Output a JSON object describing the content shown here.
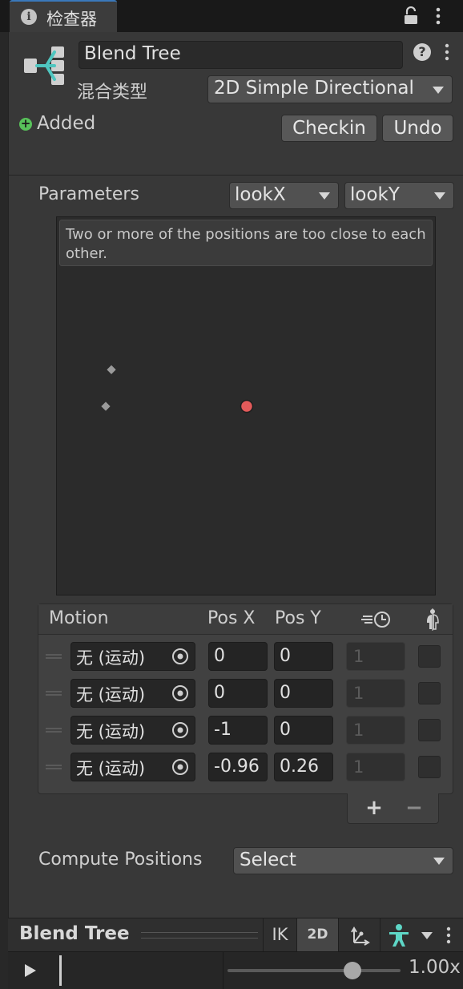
{
  "tab": {
    "title": "检查器",
    "info_icon": "info-icon",
    "lock_icon": "lock-icon",
    "menu_icon": "kebab-menu-icon"
  },
  "header": {
    "name_value": "Blend Tree",
    "help_icon": "help-icon",
    "blend_type_label": "混合类型",
    "blend_type_value": "2D Simple Directional",
    "added_label": "Added",
    "checkin_label": "Checkin",
    "undo_label": "Undo"
  },
  "parameters": {
    "label": "Parameters",
    "param_x": "lookX",
    "param_y": "lookY"
  },
  "blend_graph": {
    "warning": "Two or more of the positions are too close to each other.",
    "points": [
      {
        "x": 0,
        "y": 0
      },
      {
        "x": 0,
        "y": 0
      },
      {
        "x": -1,
        "y": 0
      },
      {
        "x": -0.96,
        "y": 0.26
      }
    ],
    "colors": {
      "point": "#9a9a9a",
      "current": "#e35a5a"
    }
  },
  "motion_table": {
    "headers": {
      "motion": "Motion",
      "pos_x": "Pos X",
      "pos_y": "Pos Y",
      "speed_icon": "time-scale-icon",
      "mirror_icon": "mirror-icon"
    },
    "rows": [
      {
        "motion": "无 (运动)",
        "pos_x": "0",
        "pos_y": "0",
        "speed": "1"
      },
      {
        "motion": "无 (运动)",
        "pos_x": "0",
        "pos_y": "0",
        "speed": "1"
      },
      {
        "motion": "无 (运动)",
        "pos_x": "-1",
        "pos_y": "0",
        "speed": "1"
      },
      {
        "motion": "无 (运动)",
        "pos_x": "-0.96",
        "pos_y": "0.26",
        "speed": "1"
      }
    ],
    "add_label": "+",
    "remove_label": "−"
  },
  "compute": {
    "label": "Compute Positions",
    "value": "Select"
  },
  "bottom": {
    "title": "Blend Tree",
    "ik_label": "IK",
    "mode_2d_label": "2D",
    "pivot_icon": "pivot-axes-icon",
    "avatar_icon": "avatar-icon",
    "menu_icon": "kebab-menu-icon"
  },
  "playback": {
    "play_icon": "play-icon",
    "speed_value": "1.00x",
    "slider_level": 0.72
  }
}
